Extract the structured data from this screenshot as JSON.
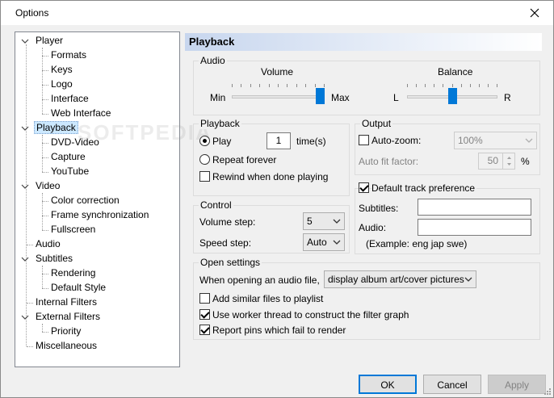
{
  "window": {
    "title": "Options"
  },
  "tree": [
    {
      "label": "Player",
      "level": 0,
      "expandable": true
    },
    {
      "label": "Formats",
      "level": 1
    },
    {
      "label": "Keys",
      "level": 1
    },
    {
      "label": "Logo",
      "level": 1
    },
    {
      "label": "Interface",
      "level": 1
    },
    {
      "label": "Web Interface",
      "level": 1
    },
    {
      "label": "Playback",
      "level": 0,
      "expandable": true,
      "selected": true
    },
    {
      "label": "DVD-Video",
      "level": 1
    },
    {
      "label": "Capture",
      "level": 1
    },
    {
      "label": "YouTube",
      "level": 1
    },
    {
      "label": "Video",
      "level": 0,
      "expandable": true
    },
    {
      "label": "Color correction",
      "level": 1
    },
    {
      "label": "Frame synchronization",
      "level": 1
    },
    {
      "label": "Fullscreen",
      "level": 1
    },
    {
      "label": "Audio",
      "level": 0
    },
    {
      "label": "Subtitles",
      "level": 0,
      "expandable": true
    },
    {
      "label": "Rendering",
      "level": 1
    },
    {
      "label": "Default Style",
      "level": 1
    },
    {
      "label": "Internal Filters",
      "level": 0
    },
    {
      "label": "External Filters",
      "level": 0,
      "expandable": true
    },
    {
      "label": "Priority",
      "level": 1
    },
    {
      "label": "Miscellaneous",
      "level": 0
    }
  ],
  "page": {
    "header": "Playback",
    "audio": {
      "title": "Audio",
      "volume_label": "Volume",
      "volume_min": "Min",
      "volume_max": "Max",
      "volume_level": 1.0,
      "balance_label": "Balance",
      "balance_left": "L",
      "balance_right": "R",
      "balance_level": 0.5
    },
    "playback": {
      "title": "Playback",
      "play_label": "Play",
      "play_count": "1",
      "times_label": "time(s)",
      "repeat_label": "Repeat forever",
      "rewind_label": "Rewind when done playing"
    },
    "output": {
      "title": "Output",
      "autozoom_label": "Auto-zoom:",
      "autozoom_value": "100%",
      "autofit_label": "Auto fit factor:",
      "autofit_value": "50",
      "autofit_unit": "%"
    },
    "track": {
      "title": "Default track preference",
      "subtitles_label": "Subtitles:",
      "subtitles_value": "",
      "audio_label": "Audio:",
      "audio_value": "",
      "example": "(Example: eng jap swe)"
    },
    "control": {
      "title": "Control",
      "volume_step_label": "Volume step:",
      "volume_step_value": "5",
      "speed_step_label": "Speed step:",
      "speed_step_value": "Auto"
    },
    "open": {
      "title": "Open settings",
      "audio_file_label": "When opening an audio file,",
      "audio_file_value": "display album art/cover pictures",
      "add_similar_label": "Add similar files to playlist",
      "worker_thread_label": "Use worker thread to construct the filter graph",
      "report_pins_label": "Report pins which fail to render"
    }
  },
  "buttons": {
    "ok": "OK",
    "cancel": "Cancel",
    "apply": "Apply"
  }
}
